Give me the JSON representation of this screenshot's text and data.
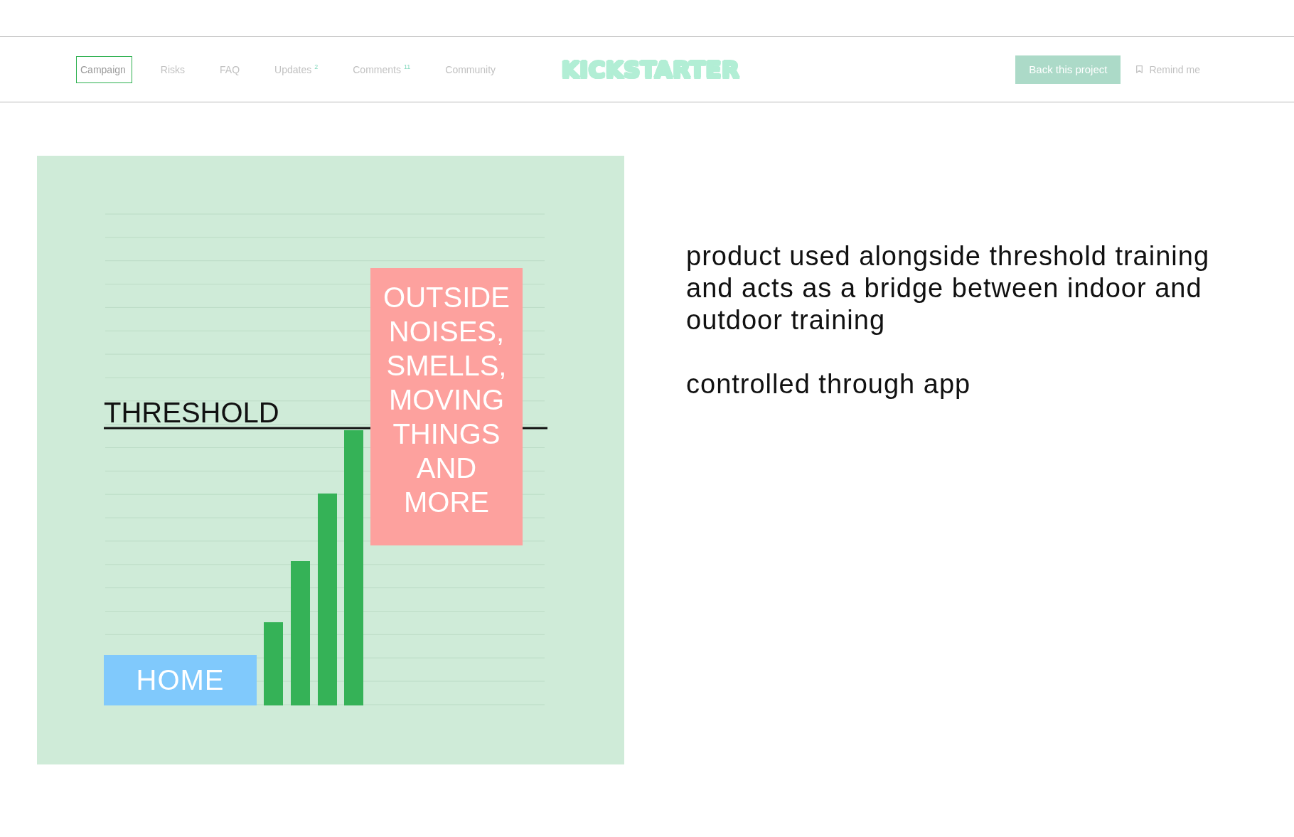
{
  "header": {
    "tabs": [
      {
        "label": "Campaign",
        "selected": true
      },
      {
        "label": "Risks",
        "selected": false
      },
      {
        "label": "FAQ",
        "selected": false
      },
      {
        "label": "Updates",
        "count": "2",
        "selected": false
      },
      {
        "label": "Comments",
        "count": "11",
        "selected": false
      },
      {
        "label": "Community",
        "selected": false
      }
    ],
    "logo": "KICKSTARTER",
    "back_button": "Back this project",
    "remind_link": "Remind me"
  },
  "illustration": {
    "threshold_label": "THRESHOLD",
    "outside_label": "OUTSIDE NOISES, SMELLS, MOVING THINGS AND MORE",
    "home_label": "HOME"
  },
  "description": [
    "product used alongside threshold training and acts as a bridge between indoor and outdoor training",
    "controlled through app"
  ]
}
